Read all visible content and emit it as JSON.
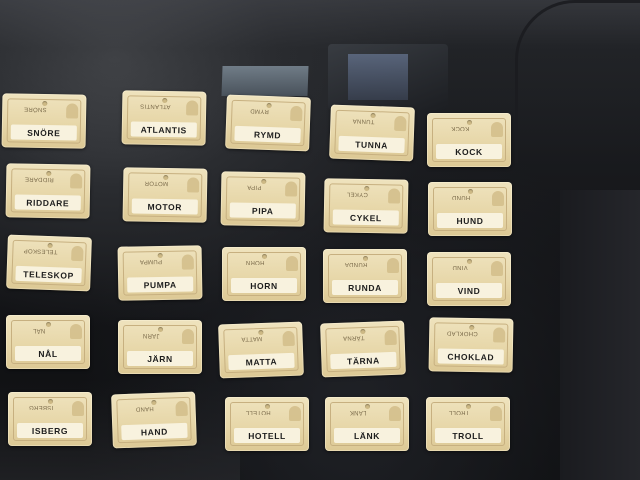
{
  "cards": [
    {
      "word": "SNÖRE"
    },
    {
      "word": "ATLANTIS"
    },
    {
      "word": "RYMD"
    },
    {
      "word": "TUNNA"
    },
    {
      "word": "KOCK"
    },
    {
      "word": "RIDDARE"
    },
    {
      "word": "MOTOR"
    },
    {
      "word": "PIPA"
    },
    {
      "word": "CYKEL"
    },
    {
      "word": "HUND"
    },
    {
      "word": "TELESKOP"
    },
    {
      "word": "PUMPA"
    },
    {
      "word": "HORN"
    },
    {
      "word": "RUNDA"
    },
    {
      "word": "VIND"
    },
    {
      "word": "NÅL"
    },
    {
      "word": "JÄRN"
    },
    {
      "word": "MATTA"
    },
    {
      "word": "TÄRNA"
    },
    {
      "word": "CHOKLAD"
    },
    {
      "word": "ISBERG"
    },
    {
      "word": "HAND"
    },
    {
      "word": "HOTELL"
    },
    {
      "word": "LÄNK"
    },
    {
      "word": "TROLL"
    }
  ]
}
